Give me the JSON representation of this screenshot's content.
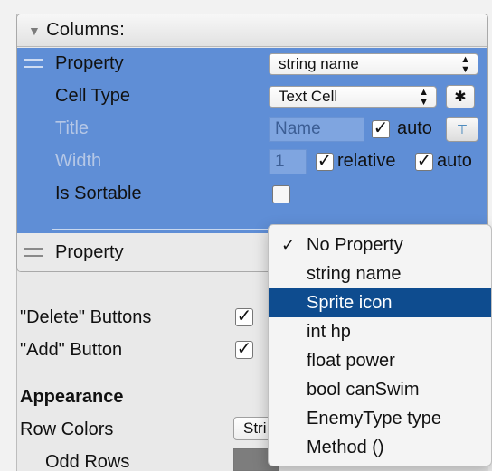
{
  "panel": {
    "header_icon": "triangle-down-icon",
    "title": "Columns:"
  },
  "column1": {
    "property_label": "Property",
    "property_value": "string name",
    "cell_type_label": "Cell Type",
    "cell_type_value": "Text Cell",
    "title_label": "Title",
    "title_placeholder": "Name",
    "title_auto_checked": true,
    "title_auto_label": "auto",
    "width_label": "Width",
    "width_value": "1",
    "width_relative_checked": true,
    "width_relative_label": "relative",
    "width_auto_checked": true,
    "width_auto_label": "auto",
    "sortable_label": "Is Sortable",
    "sortable_checked": false
  },
  "column2": {
    "property_label": "Property"
  },
  "settings": {
    "delete_buttons_label": "\"Delete\" Buttons",
    "delete_buttons_checked": true,
    "add_button_label": "\"Add\" Button",
    "add_button_checked": true,
    "appearance_heading": "Appearance",
    "row_colors_label": "Row Colors",
    "row_colors_value": "Stri",
    "odd_rows_label": "Odd Rows",
    "odd_rows_color": "#7d7d7d"
  },
  "menu": {
    "items": [
      {
        "label": "No Property",
        "checked": true
      },
      {
        "label": "string name",
        "checked": false
      },
      {
        "label": "Sprite icon",
        "checked": false,
        "highlighted": true
      },
      {
        "label": "int hp",
        "checked": false
      },
      {
        "label": "float power",
        "checked": false
      },
      {
        "label": "bool canSwim",
        "checked": false
      },
      {
        "label": "EnemyType type",
        "checked": false
      },
      {
        "label": "Method ()",
        "checked": false
      }
    ]
  },
  "colors": {
    "selection_blue": "#5f8ed6",
    "menu_highlight": "#0e4c8f"
  }
}
